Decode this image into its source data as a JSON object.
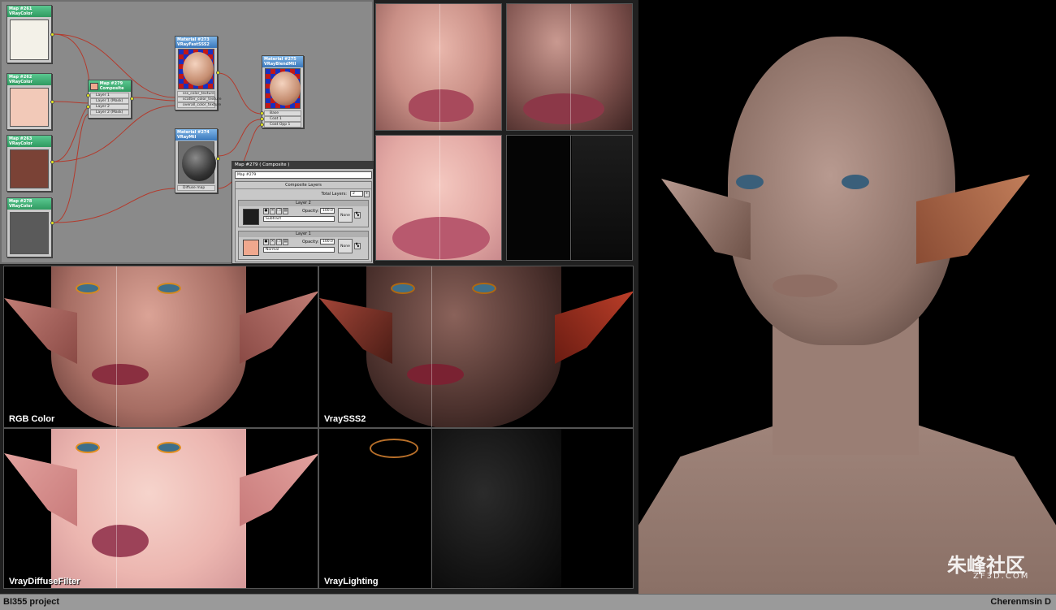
{
  "nodes": {
    "m261": {
      "num": "Map #261",
      "type": "VRayColor",
      "color": "#f3f1e8"
    },
    "m262": {
      "num": "Map #262",
      "type": "VRayColor",
      "color": "#f2c9b8"
    },
    "m263": {
      "num": "Map #263",
      "type": "VRayColor",
      "color": "#7a4236"
    },
    "m278": {
      "num": "Map #278",
      "type": "VRayColor",
      "color": "#5a5a5a"
    },
    "m279": {
      "num": "Map #279",
      "type": "Composite",
      "slots": [
        "Layer 1",
        "Layer 1 (Mask)",
        "Layer 2",
        "Layer 2 (Mask)"
      ]
    },
    "mat273": {
      "num": "Material #273",
      "type": "VRayFastSSS2",
      "slots": [
        "sss_color_texture",
        "scatter_color_texture",
        "overall_color_texture"
      ]
    },
    "mat274": {
      "num": "Material #274",
      "type": "VRayMtl",
      "slots": [
        "Diffuse map"
      ]
    },
    "mat275": {
      "num": "Material #275",
      "type": "VRayBlendMtl",
      "slots": [
        "Base",
        "Coat 1",
        "Coat Opp 1"
      ]
    }
  },
  "panel": {
    "title": "Map #279  ( Composite )",
    "name_field": "Map #279",
    "section": "Composite Layers",
    "total_label": "Total Layers:",
    "total_value": "2",
    "layers": [
      {
        "title": "Layer 2",
        "opacity_label": "Opacity:",
        "opacity": "100.0",
        "blend": "Subtract",
        "mask": "None",
        "color": "#1e1e1e"
      },
      {
        "title": "Layer 1",
        "opacity_label": "Opacity:",
        "opacity": "100.0",
        "blend": "Normal",
        "mask": "None",
        "color": "#f0a88e"
      }
    ]
  },
  "renders": {
    "rgb": "RGB Color",
    "sss": "VraySSS2",
    "diffuse": "VrayDiffuseFilter",
    "lighting": "VrayLighting"
  },
  "footer": {
    "left": "BI355 project",
    "right": "Cherenmsin D"
  },
  "watermark": {
    "cn": "朱峰社区",
    "url": "ZF3D.COM"
  }
}
